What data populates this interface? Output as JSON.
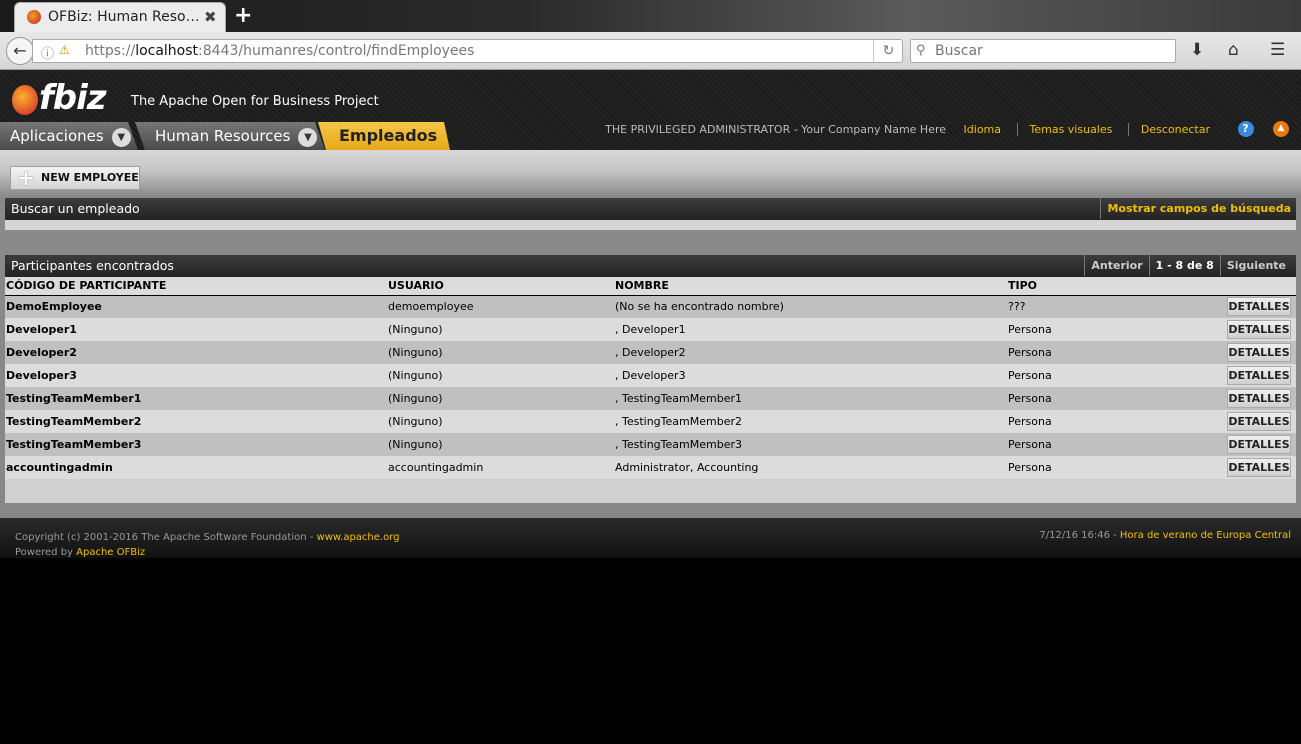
{
  "browser": {
    "tab_title": "OFBiz: Human Reso…",
    "tab_close": "✖",
    "new_tab": "+",
    "url_protocol": "https://",
    "url_host": "localhost",
    "url_rest": ":8443/humanres/control/findEmployees",
    "search_placeholder": "Buscar",
    "icons": [
      "back-arrow-icon",
      "info-icon",
      "lock-warning-icon",
      "reload-icon",
      "search-icon",
      "download-icon",
      "home-icon",
      "menu-icon"
    ]
  },
  "header": {
    "logo_text": "fbiz",
    "tagline": "The Apache Open for Business Project",
    "apps_tab": "Aplicaciones",
    "hr_tab": "Human Resources",
    "employees_tab": "Empleados",
    "user": "THE PRIVILEGED ADMINISTRATOR - Your Company Name Here",
    "links": [
      "Idioma",
      "Temas visuales",
      "Desconectar"
    ],
    "help": "?",
    "accent_color": "#f0c000"
  },
  "content": {
    "new_employee_label": "NEW EMPLOYEE",
    "search_title": "Buscar un empleado",
    "show_search_fields": "Mostrar campos de búsqueda",
    "results_title": "Participantes encontrados",
    "pager": {
      "previous": "Anterior",
      "range": "1 - 8 de 8",
      "next": "Siguiente"
    },
    "columns": [
      "CÓDIGO DE PARTICIPANTE",
      "USUARIO",
      "NOMBRE",
      "TIPO"
    ],
    "details_label": "DETALLES",
    "rows": [
      {
        "party_id": "DemoEmployee",
        "user": "demoemployee",
        "name": "(No se ha encontrado nombre)",
        "type": "???"
      },
      {
        "party_id": "Developer1",
        "user": "(Ninguno)",
        "name": ", Developer1",
        "type": "Persona"
      },
      {
        "party_id": "Developer2",
        "user": "(Ninguno)",
        "name": ", Developer2",
        "type": "Persona"
      },
      {
        "party_id": "Developer3",
        "user": "(Ninguno)",
        "name": ", Developer3",
        "type": "Persona"
      },
      {
        "party_id": "TestingTeamMember1",
        "user": "(Ninguno)",
        "name": ", TestingTeamMember1",
        "type": "Persona"
      },
      {
        "party_id": "TestingTeamMember2",
        "user": "(Ninguno)",
        "name": ", TestingTeamMember2",
        "type": "Persona"
      },
      {
        "party_id": "TestingTeamMember3",
        "user": "(Ninguno)",
        "name": ", TestingTeamMember3",
        "type": "Persona"
      },
      {
        "party_id": "accountingadmin",
        "user": "accountingadmin",
        "name": "Administrator, Accounting",
        "type": "Persona"
      }
    ]
  },
  "footer": {
    "copyright": "Copyright (c) 2001-2016 The Apache Software Foundation - ",
    "apache_link": "www.apache.org",
    "powered_by": "Powered by ",
    "ofbiz_link": "Apache OFBiz",
    "timestamp": "7/12/16 16:46 - ",
    "timezone_link": "Hora de verano de Europa Central"
  }
}
